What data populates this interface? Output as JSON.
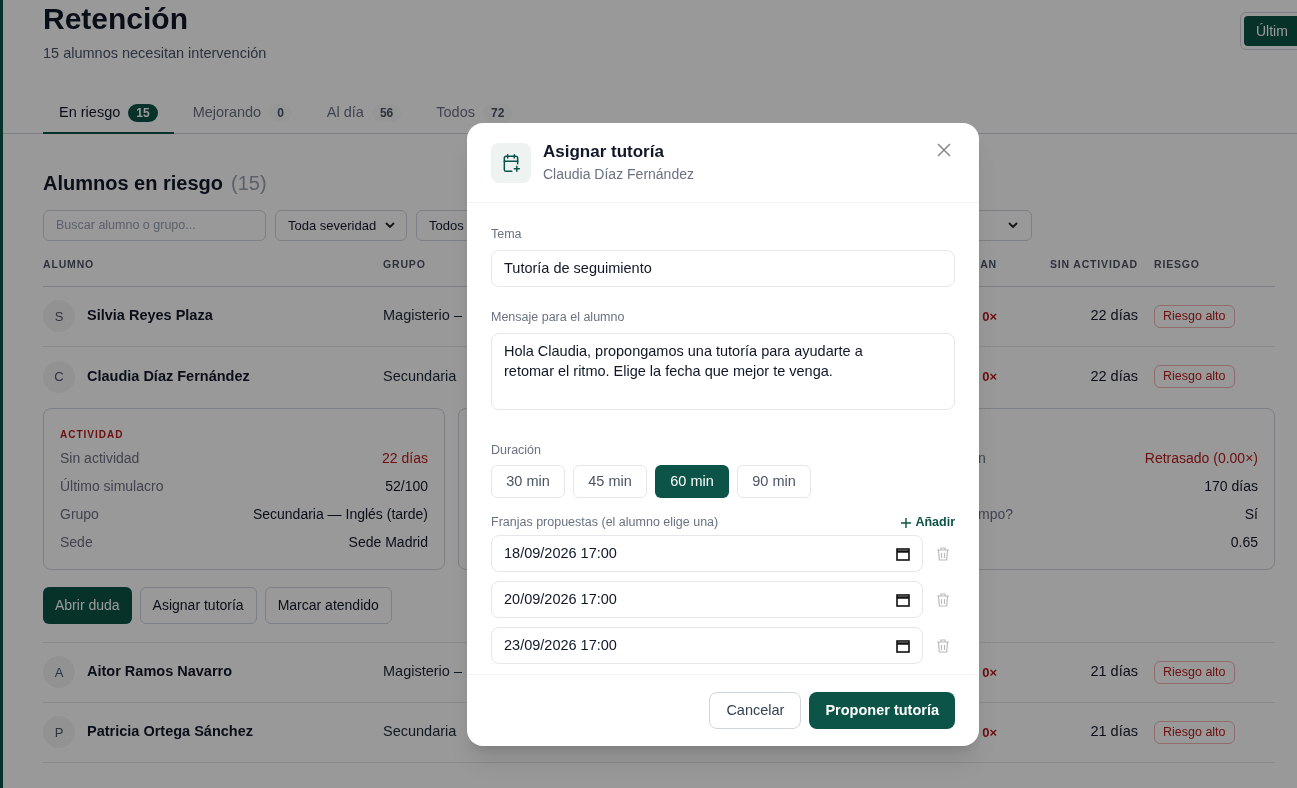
{
  "page": {
    "title": "Retención",
    "subtitle": "15 alumnos necesitan intervención",
    "top_button": "Últim"
  },
  "tabs": [
    {
      "label": "En riesgo",
      "count": "15",
      "selected": true
    },
    {
      "label": "Mejorando",
      "count": "0",
      "selected": false
    },
    {
      "label": "Al día",
      "count": "56",
      "selected": false
    },
    {
      "label": "Todos",
      "count": "72",
      "selected": false
    }
  ],
  "section": {
    "title": "Alumnos en riesgo",
    "count": "(15)"
  },
  "filters": [
    {
      "kind": "search",
      "placeholder": "Buscar alumno o grupo..."
    },
    {
      "kind": "select",
      "value": "Toda severidad"
    },
    {
      "kind": "select",
      "value": "Todos"
    },
    {
      "kind": "select"
    }
  ],
  "table": {
    "columns": [
      "ALUMNO",
      "GRUPO",
      "AN",
      "SIN ACTIVIDAD",
      "RIESGO"
    ],
    "rows": [
      {
        "initial": "S",
        "name": "Silvia Reyes Plaza",
        "group": "Magisterio –",
        "plan": "0×",
        "inactivity": "22 días",
        "risk": "Riesgo alto",
        "expanded": false
      },
      {
        "initial": "C",
        "name": "Claudia Díaz Fernández",
        "group": "Secundaria",
        "plan": "0×",
        "inactivity": "22 días",
        "risk": "Riesgo alto",
        "expanded": true,
        "details": {
          "cards": [
            {
              "title": "ACTIVIDAD",
              "items": [
                {
                  "label": "Sin actividad",
                  "value": "22 días",
                  "alert": true
                },
                {
                  "label": "Último simulacro",
                  "value": "52/100",
                  "alert": false
                },
                {
                  "label": "Grupo",
                  "value": "Secundaria — Inglés (tarde)",
                  "alert": false
                },
                {
                  "label": "Sede",
                  "value": "Sede Madrid",
                  "alert": false
                }
              ]
            },
            {
              "items": [
                {
                  "label": "n",
                  "value": "Retrasado (0.00×)",
                  "alert": true
                },
                {
                  "value": "170 días",
                  "alert": false
                },
                {
                  "label": "mpo?",
                  "value": "Sí",
                  "alert": false
                },
                {
                  "value": "0.65",
                  "alert": false
                }
              ]
            }
          ],
          "actions": [
            {
              "label": "Abrir duda",
              "primary": true
            },
            {
              "label": "Asignar tutoría",
              "primary": false
            },
            {
              "label": "Marcar atendido",
              "primary": false
            }
          ]
        }
      },
      {
        "initial": "A",
        "name": "Aitor Ramos Navarro",
        "group": "Magisterio –",
        "plan": "0×",
        "inactivity": "21 días",
        "risk": "Riesgo alto",
        "expanded": false
      },
      {
        "initial": "P",
        "name": "Patricia Ortega Sánchez",
        "group": "Secundaria",
        "plan": "0×",
        "inactivity": "21 días",
        "risk": "Riesgo alto",
        "expanded": false
      }
    ]
  },
  "modal": {
    "title": "Asignar tutoría",
    "subtitle": "Claudia Díaz Fernández",
    "topic": {
      "label": "Tema",
      "value": "Tutoría de seguimiento"
    },
    "message": {
      "label": "Mensaje para el alumno",
      "value": "Hola Claudia, propongamos una tutoría para ayudarte a retomar el ritmo. Elige la fecha que mejor te venga."
    },
    "duration": {
      "label": "Duración",
      "options": [
        {
          "label": "30 min",
          "selected": false
        },
        {
          "label": "45 min",
          "selected": false
        },
        {
          "label": "60 min",
          "selected": true
        },
        {
          "label": "90 min",
          "selected": false
        }
      ]
    },
    "slots": {
      "label": "Franjas propuestas (el alumno elige una)",
      "add": "Añadir",
      "items": [
        "18/09/2026 17:00",
        "20/09/2026 17:00",
        "23/09/2026 17:00"
      ]
    },
    "buttons": [
      {
        "label": "Cancelar",
        "primary": false
      },
      {
        "label": "Proponer tutoría",
        "primary": true
      }
    ]
  }
}
